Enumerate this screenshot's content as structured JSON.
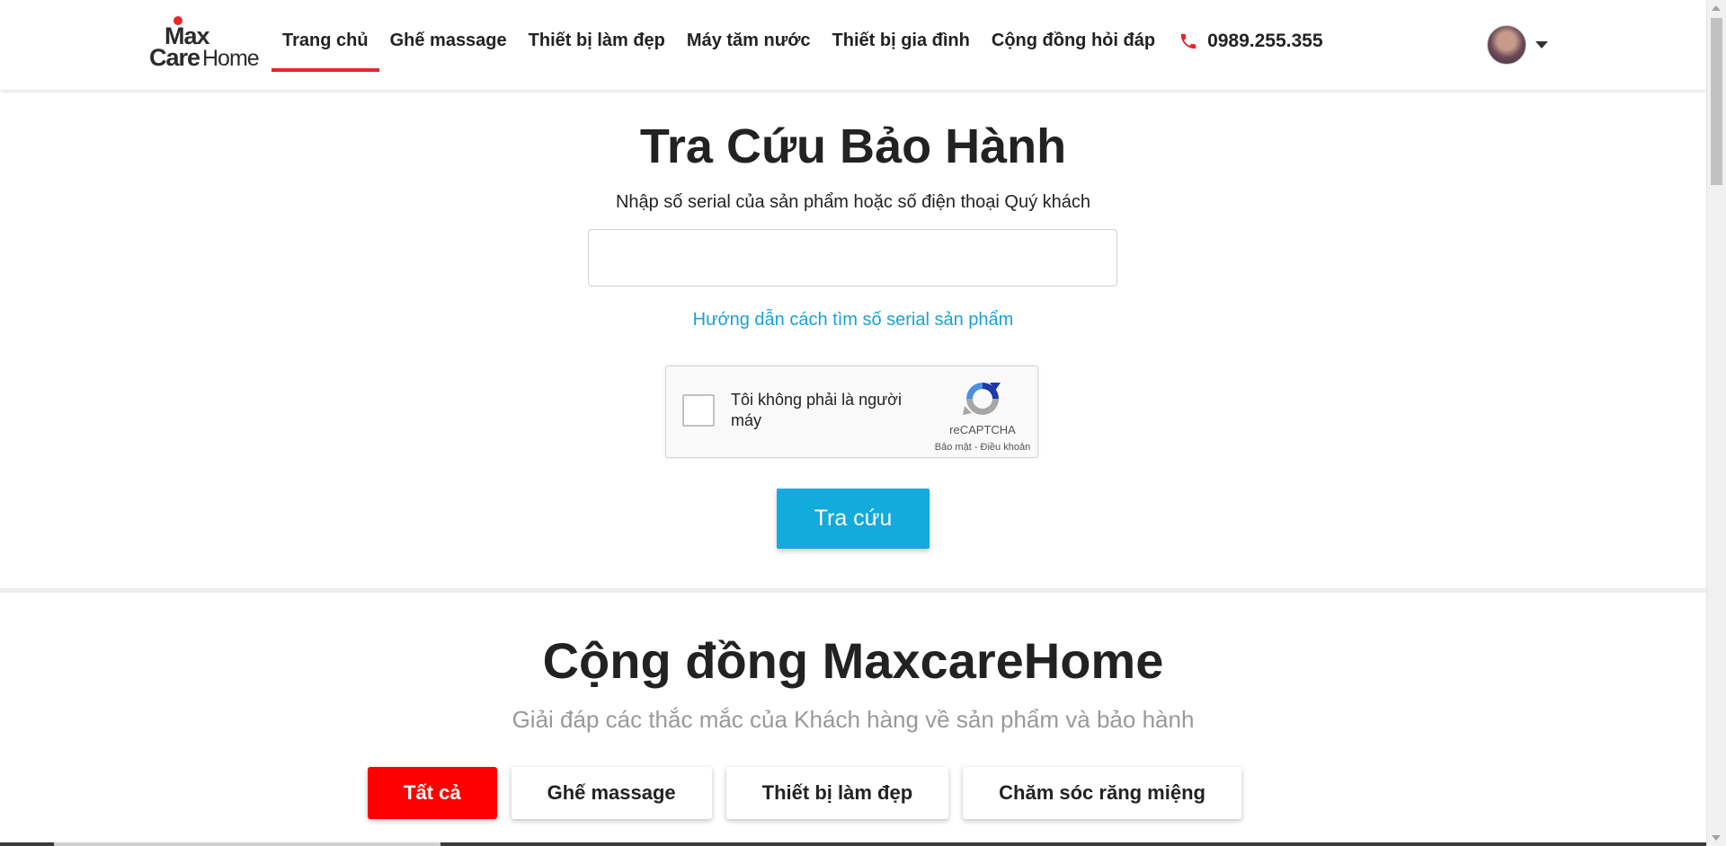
{
  "header": {
    "logo": {
      "line1": "Max",
      "line2_bold": "Care",
      "line2_light": "Home",
      "accent": "#e8262b"
    },
    "nav": [
      {
        "label": "Trang chủ",
        "active": true
      },
      {
        "label": "Ghế massage"
      },
      {
        "label": "Thiết bị làm đẹp"
      },
      {
        "label": "Máy tăm nước"
      },
      {
        "label": "Thiết bị gia đình"
      },
      {
        "label": "Cộng đồng hỏi đáp"
      }
    ],
    "phone": {
      "icon": "phone-icon",
      "number": "0989.255.355",
      "icon_color": "#e8262b"
    },
    "user": {
      "avatar": "avatar",
      "menu_icon": "caret-down-icon"
    }
  },
  "warranty": {
    "title": "Tra Cứu Bảo Hành",
    "subtitle": "Nhập số serial của sản phẩm hoặc số điện thoại Quý khách",
    "input_value": "",
    "help_link": "Hướng dẫn cách tìm số serial sản phẩm",
    "captcha": {
      "label": "Tôi không phải là người máy",
      "brand": "reCAPTCHA",
      "links": "Bảo mật - Điều khoản"
    },
    "button": "Tra cứu",
    "button_color": "#13aadd",
    "link_color": "#1aa1d8"
  },
  "community": {
    "title": "Cộng đồng MaxcareHome",
    "subtitle": "Giải đáp các thắc mắc của Khách hàng về sản phẩm và bảo hành",
    "filters": [
      {
        "label": "Tất cả",
        "active": true
      },
      {
        "label": "Ghế massage"
      },
      {
        "label": "Thiết bị làm đẹp"
      },
      {
        "label": "Chăm sóc răng miệng"
      }
    ],
    "active_color": "#ff0000"
  }
}
